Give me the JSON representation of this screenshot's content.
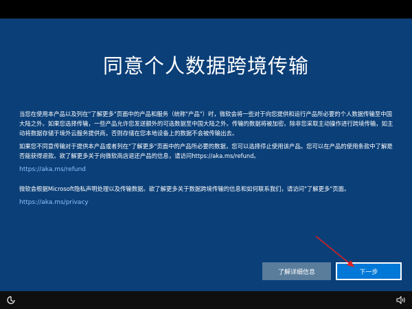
{
  "page": {
    "title": "同意个人数据跨境传输",
    "paragraphs": [
      "当您在使用本产品以及列在\"了解更多\"页面中的产品和服务（统称\"产品\"）时，微软会将一些对于向您提供和运行产品所必要的个人数据传输至中国大陆之外。如果您选择传输，一些产品允许您发送额外的可选数据至中国大陆之外。传输的数据将被加密。除非您采取主动操作进行跨境传输，如主动将数据存储于境外云服务提供商，否则存储在您本地设备上的数据不会被传输出去。",
      "如果您不同意传输对于提供本产品或者列在\"了解更多\"页面中的产品所必要的数据，您可以选择停止使用该产品。您可以在产品的使用条款中了解是否能获得退款。欲了解更多关于向微软商店退还产品的信息，请访问https://aka.ms/refund。"
    ],
    "link_refund": "https://aka.ms/refund",
    "paragraph_privacy": "微软会根据Microsoft隐私声明处理以及传输数据。欲了解更多关于数据跨境传输的信息和如何联系我们，请访问\"了解更多\"页面。",
    "link_privacy": "https://aka.ms/privacy"
  },
  "buttons": {
    "learn_more": "了解详细信息",
    "next": "下一步"
  },
  "bottom_bar": {
    "ease_icon": "ease-of-access-icon",
    "volume_icon": "volume-icon"
  },
  "colors": {
    "panel": "#0b3f78",
    "accent": "#0078d7",
    "link": "#8fc3ff",
    "annotation_arrow": "#e02020"
  }
}
